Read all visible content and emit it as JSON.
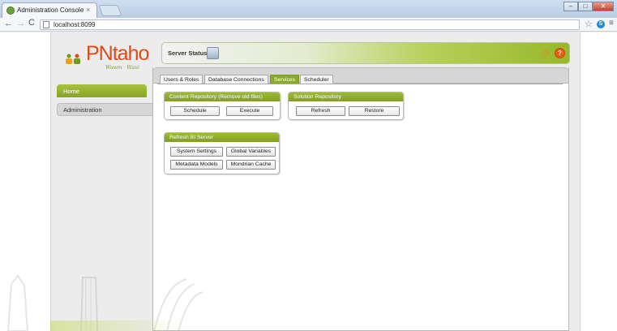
{
  "browser": {
    "tab_title": "Administration Console",
    "tab_close": "×",
    "url": "localhost:8099",
    "back": "←",
    "forward": "→",
    "reload": "C",
    "star": "☆",
    "menu": "≡",
    "extension": "S",
    "window_minimize": "–",
    "window_maximize": "□",
    "window_close": "✕"
  },
  "header": {
    "logo_text": "PNtaho",
    "logo_sub": "Wuwm · Wuui",
    "status_label": "Server Status:",
    "refresh_glyph": "⟳",
    "help_glyph": "?"
  },
  "sidebar": {
    "items": [
      {
        "label": "Home",
        "active": true
      },
      {
        "label": "Administration",
        "active": false
      }
    ]
  },
  "tabs": [
    {
      "label": "Users & Roles",
      "active": false
    },
    {
      "label": "Database Connections",
      "active": false
    },
    {
      "label": "Services",
      "active": true
    },
    {
      "label": "Scheduler",
      "active": false
    }
  ],
  "groups": {
    "content_repository": {
      "title": "Content Repository (Remove old files)",
      "buttons": [
        "Schedule",
        "Execute"
      ]
    },
    "solution_repository": {
      "title": "Solution Repository",
      "buttons": [
        "Refresh",
        "Restore"
      ]
    },
    "refresh_bi_server": {
      "title": "Refresh BI Server",
      "buttons": [
        "System Settings",
        "Global Variables",
        "Metadata Models",
        "Mondrian Cache"
      ]
    }
  },
  "colors": {
    "accent_green": "#8aab2a",
    "logo_orange": "#e04a16",
    "help_orange": "#e95d0f"
  },
  "icons": [
    "tab-favicon-icon",
    "page-icon",
    "star-icon",
    "server-status-icon",
    "refresh-icon",
    "help-icon",
    "logo-people-icon"
  ]
}
